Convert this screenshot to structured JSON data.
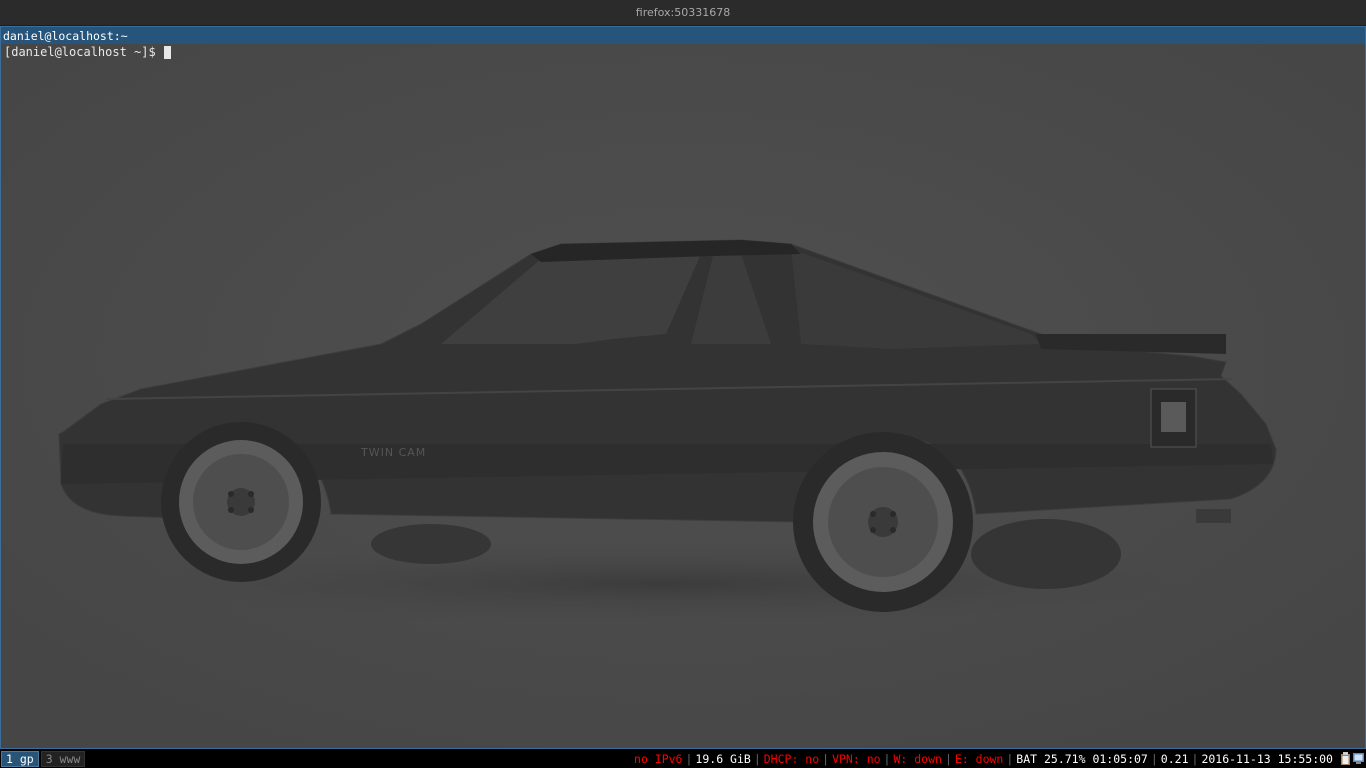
{
  "topbar": {
    "title": "firefox:50331678"
  },
  "terminal": {
    "title": "daniel@localhost:~",
    "prompt": "[daniel@localhost ~]$ "
  },
  "workspaces": [
    {
      "label": "1 gp",
      "active": true
    },
    {
      "label": "3 www",
      "active": false
    }
  ],
  "status": {
    "ipv6": "no IPv6",
    "disk": "19.6 GiB",
    "dhcp": "DHCP: no",
    "vpn": "VPN: no",
    "wireless": "W: down",
    "ethernet": "E: down",
    "battery": "BAT 25.71% 01:05:07",
    "load": "0.21",
    "datetime": "2016-11-13 15:55:00"
  },
  "tray": {
    "icons": [
      "clipboard-icon",
      "network-manager-icon"
    ]
  },
  "colors": {
    "titlebar_active": "#26547a",
    "workspace_active": "#285577",
    "status_warning": "#ff0000",
    "terminal_bg": "#4a4a4a"
  }
}
